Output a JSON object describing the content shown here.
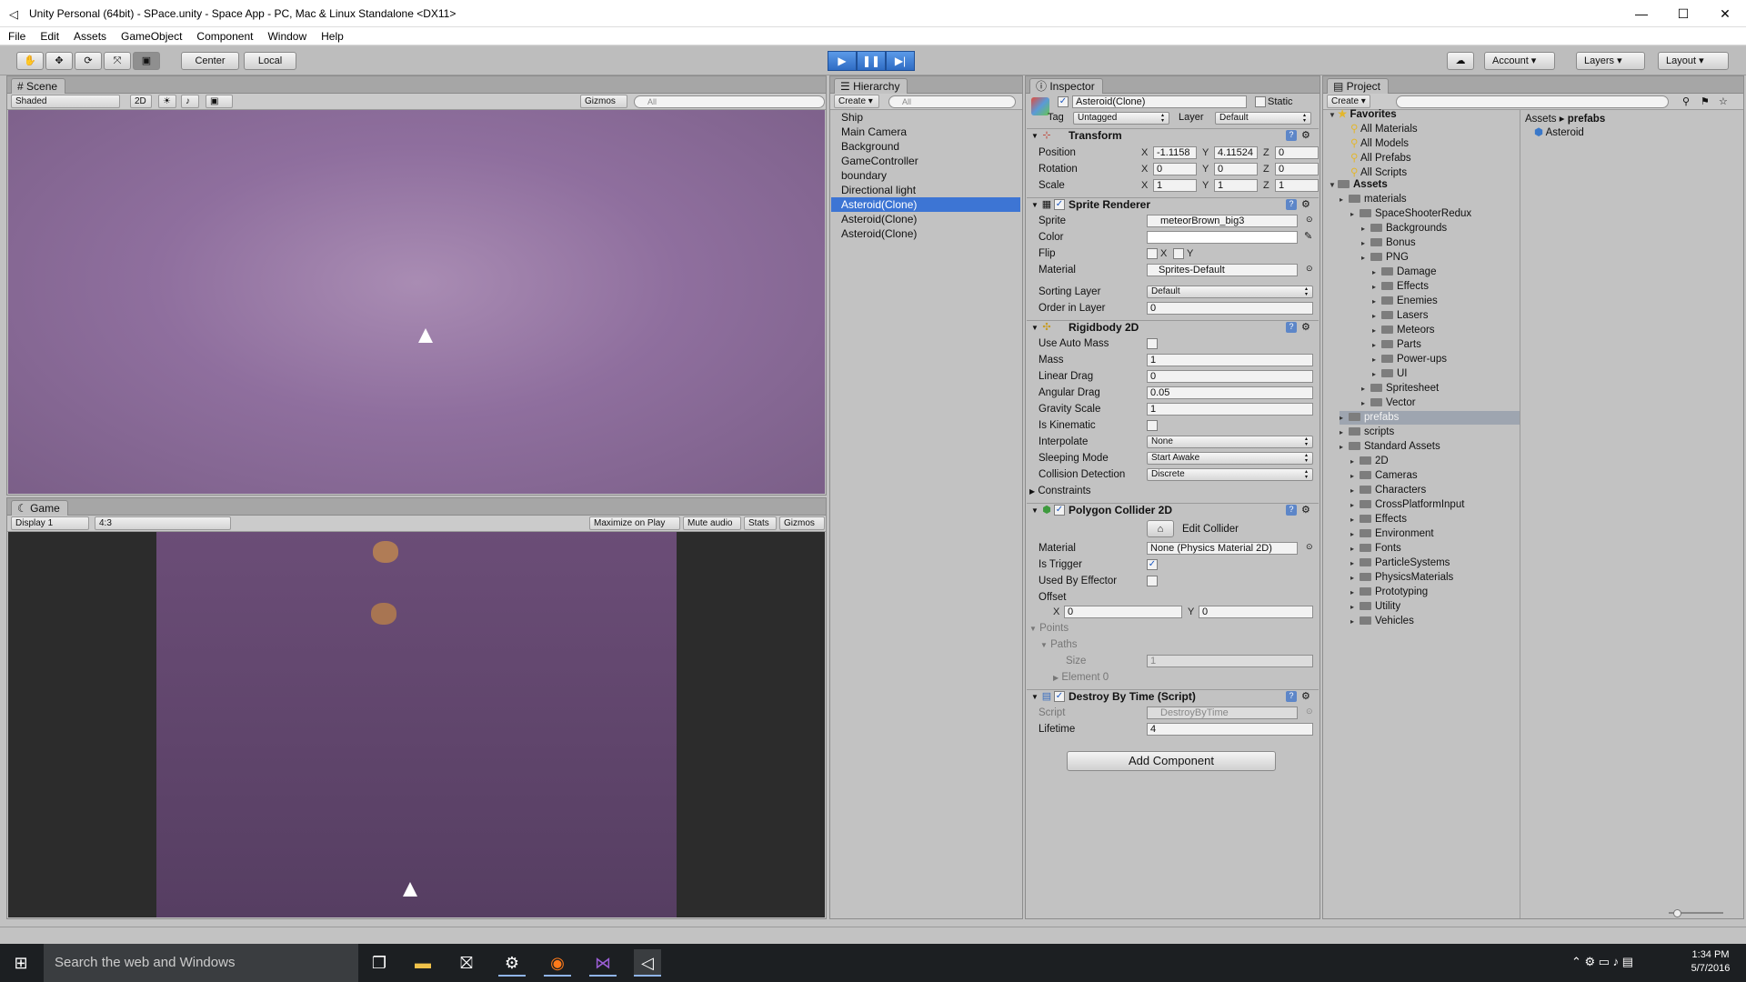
{
  "window": {
    "title": "Unity Personal (64bit) - SPace.unity - Space App - PC, Mac & Linux Standalone <DX11>",
    "minimize": "—",
    "maximize": "☐",
    "close": "✕"
  },
  "menu": [
    "File",
    "Edit",
    "Assets",
    "GameObject",
    "Component",
    "Window",
    "Help"
  ],
  "toolbar": {
    "center": "Center",
    "local": "Local",
    "account": "Account",
    "layers": "Layers",
    "layout": "Layout"
  },
  "scene": {
    "tab": "Scene",
    "shading": "Shaded",
    "mode2d": "2D",
    "gizmos": "Gizmos",
    "search_placeholder": "All"
  },
  "game": {
    "tab": "Game",
    "display": "Display 1",
    "aspect": "4:3",
    "maximize": "Maximize on Play",
    "mute": "Mute audio",
    "stats": "Stats",
    "gizmos": "Gizmos"
  },
  "hierarchy": {
    "tab": "Hierarchy",
    "create": "Create",
    "search_placeholder": "All",
    "items": [
      "Ship",
      "Main Camera",
      "Background",
      "GameController",
      "boundary",
      "Directional light",
      "Asteroid(Clone)",
      "Asteroid(Clone)",
      "Asteroid(Clone)"
    ]
  },
  "inspector": {
    "tab": "Inspector",
    "object_name": "Asteroid(Clone)",
    "static": "Static",
    "tag_label": "Tag",
    "tag": "Untagged",
    "layer_label": "Layer",
    "layer": "Default",
    "transform": {
      "title": "Transform",
      "position_label": "Position",
      "rotation_label": "Rotation",
      "scale_label": "Scale",
      "position": [
        "-1.1158",
        "4.11524",
        "0"
      ],
      "rotation": [
        "0",
        "0",
        "0"
      ],
      "scale": [
        "1",
        "1",
        "1"
      ]
    },
    "sprite_renderer": {
      "title": "Sprite Renderer",
      "sprite_label": "Sprite",
      "sprite": "meteorBrown_big3",
      "color_label": "Color",
      "flip_label": "Flip",
      "flip_x": "X",
      "flip_y": "Y",
      "material_label": "Material",
      "material": "Sprites-Default",
      "sorting_layer_label": "Sorting Layer",
      "sorting_layer": "Default",
      "order_label": "Order in Layer",
      "order": "0"
    },
    "rigidbody": {
      "title": "Rigidbody 2D",
      "auto_mass_label": "Use Auto Mass",
      "mass_label": "Mass",
      "mass": "1",
      "linear_drag_label": "Linear Drag",
      "linear_drag": "0",
      "angular_drag_label": "Angular Drag",
      "angular_drag": "0.05",
      "gravity_label": "Gravity Scale",
      "gravity": "1",
      "kinematic_label": "Is Kinematic",
      "interpolate_label": "Interpolate",
      "interpolate": "None",
      "sleeping_label": "Sleeping Mode",
      "sleeping": "Start Awake",
      "collision_label": "Collision Detection",
      "collision": "Discrete",
      "constraints_label": "Constraints"
    },
    "polygon": {
      "title": "Polygon Collider 2D",
      "edit_collider": "Edit Collider",
      "material_label": "Material",
      "material": "None (Physics Material 2D)",
      "trigger_label": "Is Trigger",
      "effector_label": "Used By Effector",
      "offset_label": "Offset",
      "offset_x": "0",
      "offset_y": "0",
      "points_label": "Points",
      "paths_label": "Paths",
      "size_label": "Size",
      "size": "1",
      "element_label": "Element 0"
    },
    "destroy": {
      "title": "Destroy By Time (Script)",
      "script_label": "Script",
      "script": "DestroyByTime",
      "lifetime_label": "Lifetime",
      "lifetime": "4"
    },
    "add_component": "Add Component"
  },
  "project": {
    "tab": "Project",
    "create": "Create",
    "breadcrumb_root": "Assets",
    "breadcrumb_current": "prefabs",
    "asset": "Asteroid",
    "favorites": "Favorites",
    "fav_items": [
      "All Materials",
      "All Models",
      "All Prefabs",
      "All Scripts"
    ],
    "assets": "Assets",
    "tree": [
      {
        "label": "materials",
        "indent": 1
      },
      {
        "label": "SpaceShooterRedux",
        "indent": 2
      },
      {
        "label": "Backgrounds",
        "indent": 3
      },
      {
        "label": "Bonus",
        "indent": 3
      },
      {
        "label": "PNG",
        "indent": 3
      },
      {
        "label": "Damage",
        "indent": 4
      },
      {
        "label": "Effects",
        "indent": 4
      },
      {
        "label": "Enemies",
        "indent": 4
      },
      {
        "label": "Lasers",
        "indent": 4
      },
      {
        "label": "Meteors",
        "indent": 4
      },
      {
        "label": "Parts",
        "indent": 4
      },
      {
        "label": "Power-ups",
        "indent": 4
      },
      {
        "label": "UI",
        "indent": 4
      },
      {
        "label": "Spritesheet",
        "indent": 3
      },
      {
        "label": "Vector",
        "indent": 3
      },
      {
        "label": "prefabs",
        "indent": 1
      },
      {
        "label": "scripts",
        "indent": 1
      },
      {
        "label": "Standard Assets",
        "indent": 1
      },
      {
        "label": "2D",
        "indent": 2
      },
      {
        "label": "Cameras",
        "indent": 2
      },
      {
        "label": "Characters",
        "indent": 2
      },
      {
        "label": "CrossPlatformInput",
        "indent": 2
      },
      {
        "label": "Effects",
        "indent": 2
      },
      {
        "label": "Environment",
        "indent": 2
      },
      {
        "label": "Fonts",
        "indent": 2
      },
      {
        "label": "ParticleSystems",
        "indent": 2
      },
      {
        "label": "PhysicsMaterials",
        "indent": 2
      },
      {
        "label": "Prototyping",
        "indent": 2
      },
      {
        "label": "Utility",
        "indent": 2
      },
      {
        "label": "Vehicles",
        "indent": 2
      }
    ]
  },
  "taskbar": {
    "search": "Search the web and Windows",
    "time": "1:34 PM",
    "date": "5/7/2016"
  }
}
